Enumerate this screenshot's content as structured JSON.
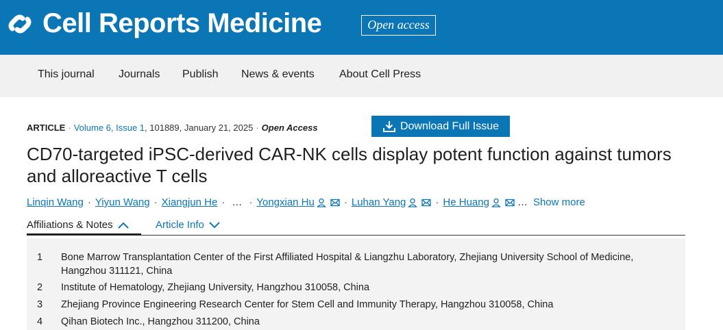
{
  "brand": {
    "title": "Cell Reports Medicine",
    "open_access_badge": "Open access",
    "color": "#0b76b6",
    "logo_icon": "cell-press-logo-icon"
  },
  "nav": {
    "items": [
      "This journal",
      "Journals",
      "Publish",
      "News & events",
      "About Cell Press"
    ]
  },
  "meta": {
    "article_type": "ARTICLE",
    "volume_issue": "Volume 6, Issue 1",
    "article_number_date": ", 101889, January 21, 2025",
    "open_access": "Open Access",
    "download_label": "Download Full Issue"
  },
  "article": {
    "title": "CD70-targeted iPSC-derived CAR-NK cells display potent function against tumors and alloreactive T cells"
  },
  "authors": {
    "list": [
      "Linqin Wang",
      "Yiyun Wang",
      "Xiangjun He",
      "Yongxian Hu",
      "Luhan Yang",
      "He Huang"
    ],
    "ellipsis": "…",
    "show_more": "Show more"
  },
  "tabs": {
    "affiliations": "Affiliations & Notes",
    "article_info": "Article Info"
  },
  "affiliations": [
    {
      "num": "1",
      "text": "Bone Marrow Transplantation Center of the First Affiliated Hospital & Liangzhu Laboratory, Zhejiang University School of Medicine, Hangzhou 311121, China"
    },
    {
      "num": "2",
      "text": "Institute of Hematology, Zhejiang University, Hangzhou 310058, China"
    },
    {
      "num": "3",
      "text": "Zhejiang Province Engineering Research Center for Stem Cell and Immunity Therapy, Hangzhou 310058, China"
    },
    {
      "num": "4",
      "text": "Qihan Biotech Inc., Hangzhou 311200, China"
    }
  ]
}
